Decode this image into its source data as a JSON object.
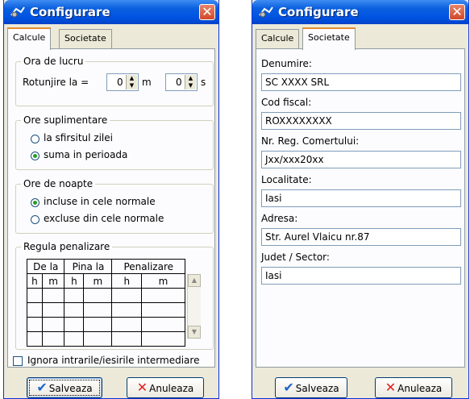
{
  "left_window": {
    "title": "Configurare",
    "tabs": [
      "Calcule",
      "Societate"
    ],
    "ora_de_lucru": {
      "legend": "Ora de lucru",
      "rotunjire_label": "Rotunjire la =",
      "minutes_value": "0",
      "minutes_unit": "m",
      "seconds_value": "0",
      "seconds_unit": "s"
    },
    "ore_suplimentare": {
      "legend": "Ore suplimentare",
      "options": [
        "la sfirsitul zilei",
        "suma in perioada"
      ],
      "selected": 1
    },
    "ore_de_noapte": {
      "legend": "Ore de noapte",
      "options": [
        "incluse in cele normale",
        "excluse din cele normale"
      ],
      "selected": 0
    },
    "regula_penalizare": {
      "legend": "Regula penalizare",
      "group_headers": [
        "De la",
        "Pina la",
        "Penalizare"
      ],
      "sub_headers": [
        "h",
        "m",
        "h",
        "m",
        "h",
        "m"
      ]
    },
    "ignora_label": "Ignora intrarile/iesirile intermediare",
    "save_label": "Salveaza",
    "cancel_label": "Anuleaza"
  },
  "right_window": {
    "title": "Configurare",
    "tabs": [
      "Calcule",
      "Societate"
    ],
    "fields": [
      {
        "label": "Denumire:",
        "value": "SC XXXX SRL"
      },
      {
        "label": "Cod fiscal:",
        "value": "ROXXXXXXXX"
      },
      {
        "label": "Nr. Reg. Comertului:",
        "value": "Jxx/xxx20xx"
      },
      {
        "label": "Localitate:",
        "value": "Iasi"
      },
      {
        "label": "Adresa:",
        "value": "Str. Aurel Vlaicu nr.87"
      },
      {
        "label": "Judet / Sector:",
        "value": "Iasi"
      }
    ],
    "save_label": "Salveaza",
    "cancel_label": "Anuleaza"
  },
  "colors": {
    "titlebar": "#0054e3",
    "close_button": "#d1482a",
    "window_bg": "#ece9d8",
    "panel_bg": "#fcfcfe",
    "radio_selected": "#21a121"
  }
}
